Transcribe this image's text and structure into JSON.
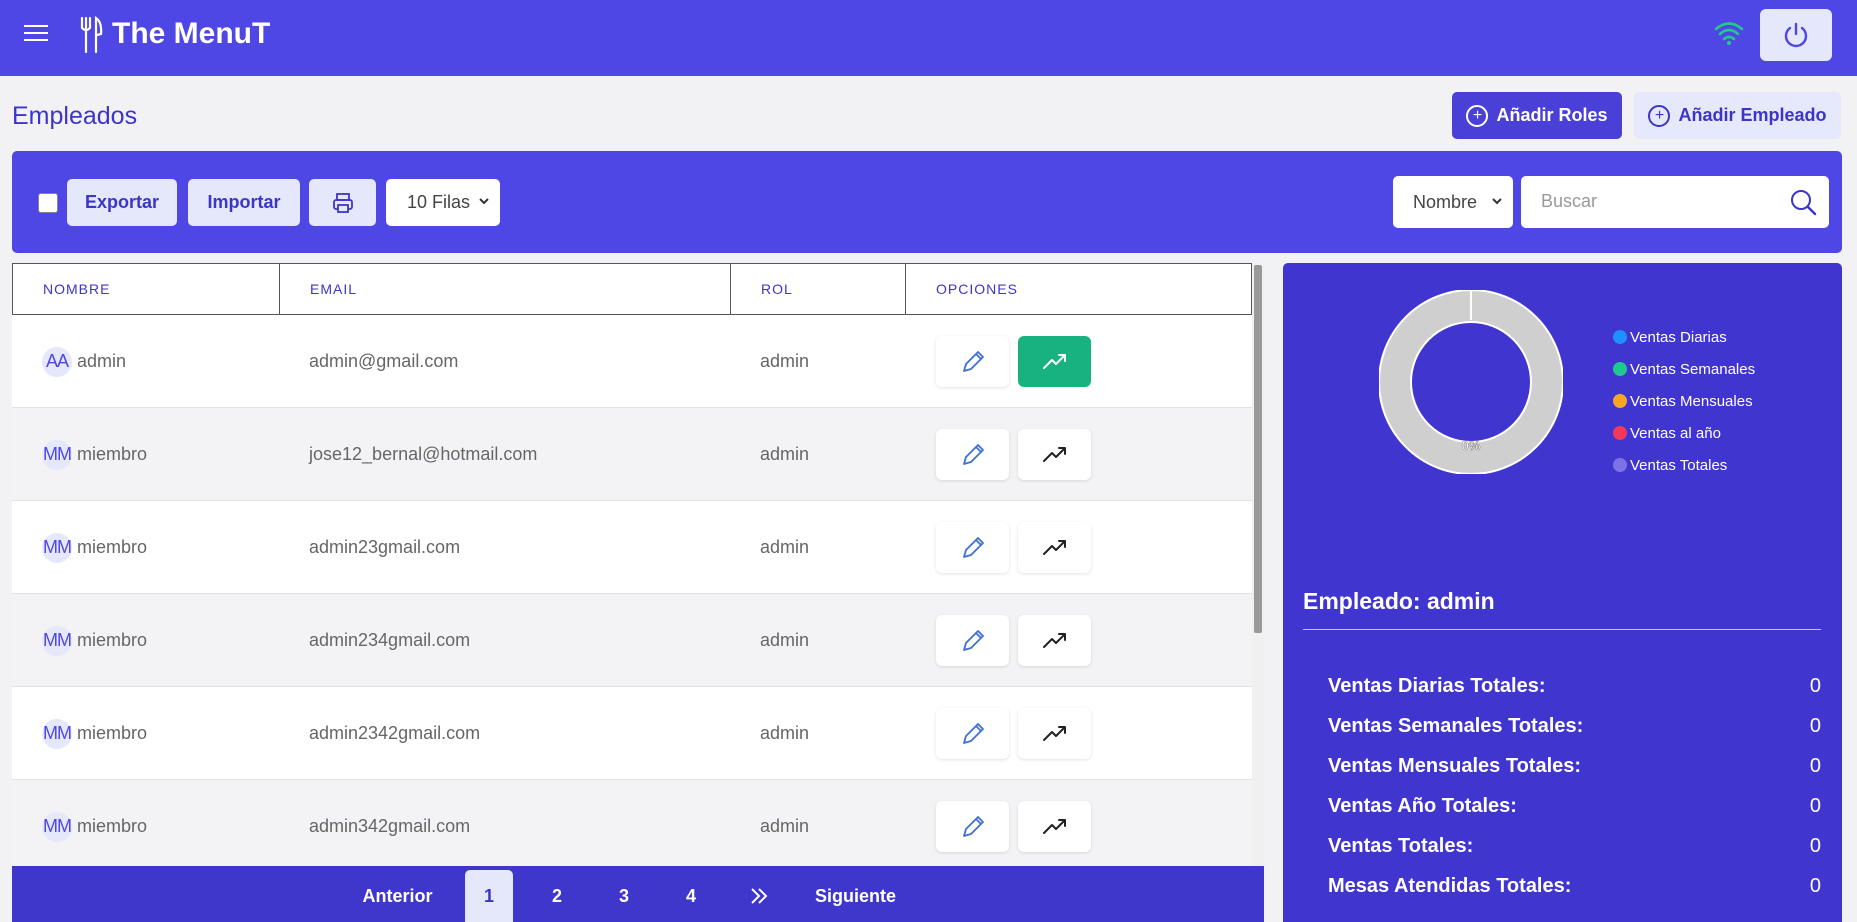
{
  "app": {
    "title": "The MenuT"
  },
  "page": {
    "title": "Empleados"
  },
  "header_actions": {
    "add_roles": "Añadir Roles",
    "add_employee": "Añadir Empleado"
  },
  "toolbar": {
    "export": "Exportar",
    "import": "Importar",
    "rows_select": "10 Filas",
    "search_field": "Nombre",
    "search_placeholder": "Buscar"
  },
  "table": {
    "columns": [
      "NOMBRE",
      "EMAIL",
      "ROL",
      "OPCIONES"
    ],
    "rows": [
      {
        "initials": "AA",
        "name": "admin",
        "email": "admin@gmail.com",
        "role": "admin"
      },
      {
        "initials": "MM",
        "name": "miembro",
        "email": "jose12_bernal@hotmail.com",
        "role": "admin"
      },
      {
        "initials": "MM",
        "name": "miembro",
        "email": "admin23gmail.com",
        "role": "admin"
      },
      {
        "initials": "MM",
        "name": "miembro",
        "email": "admin234gmail.com",
        "role": "admin"
      },
      {
        "initials": "MM",
        "name": "miembro",
        "email": "admin2342gmail.com",
        "role": "admin"
      },
      {
        "initials": "MM",
        "name": "miembro",
        "email": "admin342gmail.com",
        "role": "admin"
      }
    ]
  },
  "pagination": {
    "prev": "Anterior",
    "pages": [
      "1",
      "2",
      "3",
      "4"
    ],
    "next": "Siguiente",
    "active_page": "1"
  },
  "chart_data": {
    "type": "pie",
    "categories": [
      "Ventas Diarias",
      "Ventas Semanales",
      "Ventas Mensuales",
      "Ventas al año",
      "Ventas Totales"
    ],
    "values": [
      0,
      0,
      0,
      0,
      0
    ],
    "center_label": "0%",
    "legend_colors": [
      "#1e90ff",
      "#1ec98f",
      "#f5a623",
      "#f2385a",
      "#7d72e6"
    ],
    "legend": "right"
  },
  "employee_panel": {
    "title": "Empleado: admin",
    "stats": [
      {
        "label": "Ventas Diarias Totales:",
        "value": "0"
      },
      {
        "label": "Ventas Semanales Totales:",
        "value": "0"
      },
      {
        "label": "Ventas Mensuales Totales:",
        "value": "0"
      },
      {
        "label": "Ventas Año Totales:",
        "value": "0"
      },
      {
        "label": "Ventas Totales:",
        "value": "0"
      },
      {
        "label": "Mesas Atendidas Totales:",
        "value": "0"
      }
    ]
  },
  "colors": {
    "primary": "#4f47e5",
    "light": "#e5e7fb",
    "success": "#17b27f",
    "panel": "#4036cf"
  },
  "icons": [
    "menu-icon",
    "fork-knife-icon",
    "wifi-icon",
    "power-icon",
    "plus-circle-icon",
    "printer-icon",
    "chevron-down-icon",
    "search-icon",
    "pencil-icon",
    "trending-up-icon",
    "double-chevron-right-icon"
  ]
}
